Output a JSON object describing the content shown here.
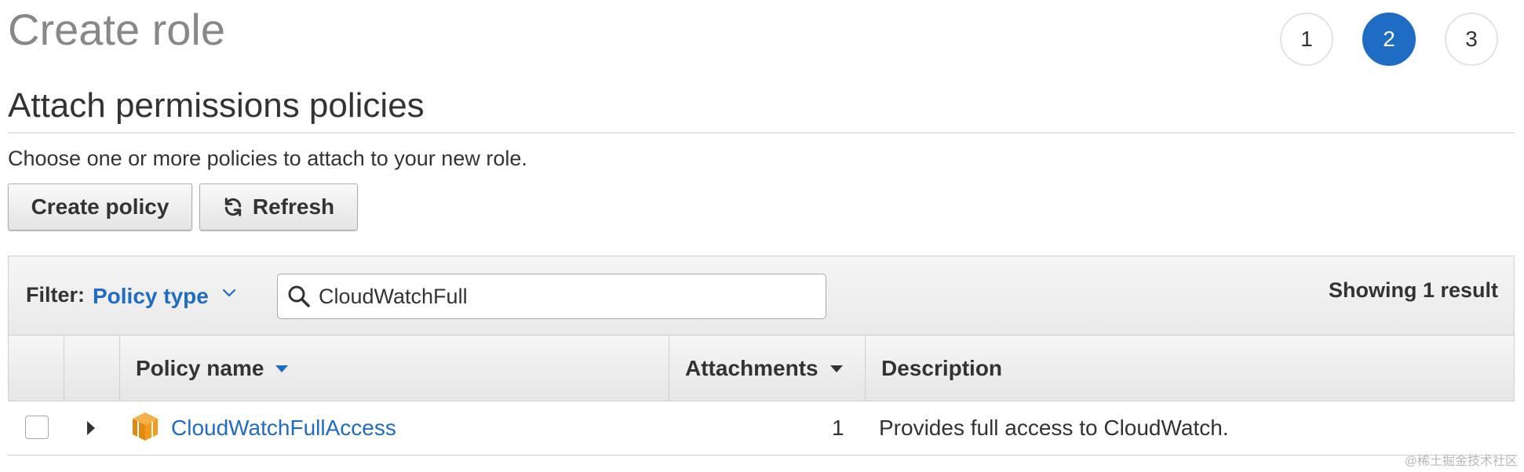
{
  "page": {
    "title": "Create role",
    "steps": [
      "1",
      "2",
      "3"
    ],
    "active_step": "2"
  },
  "section": {
    "title": "Attach permissions policies",
    "subtitle": "Choose one or more policies to attach to your new role."
  },
  "toolbar": {
    "create_policy_label": "Create policy",
    "refresh_label": "Refresh"
  },
  "filter": {
    "label": "Filter:",
    "value": "Policy type",
    "search_value": "CloudWatchFull",
    "result_text": "Showing 1 result"
  },
  "table": {
    "columns": {
      "policy_name": "Policy name",
      "attachments": "Attachments",
      "description": "Description"
    },
    "rows": [
      {
        "policy_name": "CloudWatchFullAccess",
        "attachments": "1",
        "description": "Provides full access to CloudWatch.",
        "icon": "aws-managed-policy-cube-icon"
      }
    ]
  },
  "watermark": "@稀土掘金技术社区",
  "colors": {
    "accent": "#1f6cc4",
    "title_gray": "#888888",
    "text": "#333333",
    "policy_icon": "#f29b1d"
  }
}
